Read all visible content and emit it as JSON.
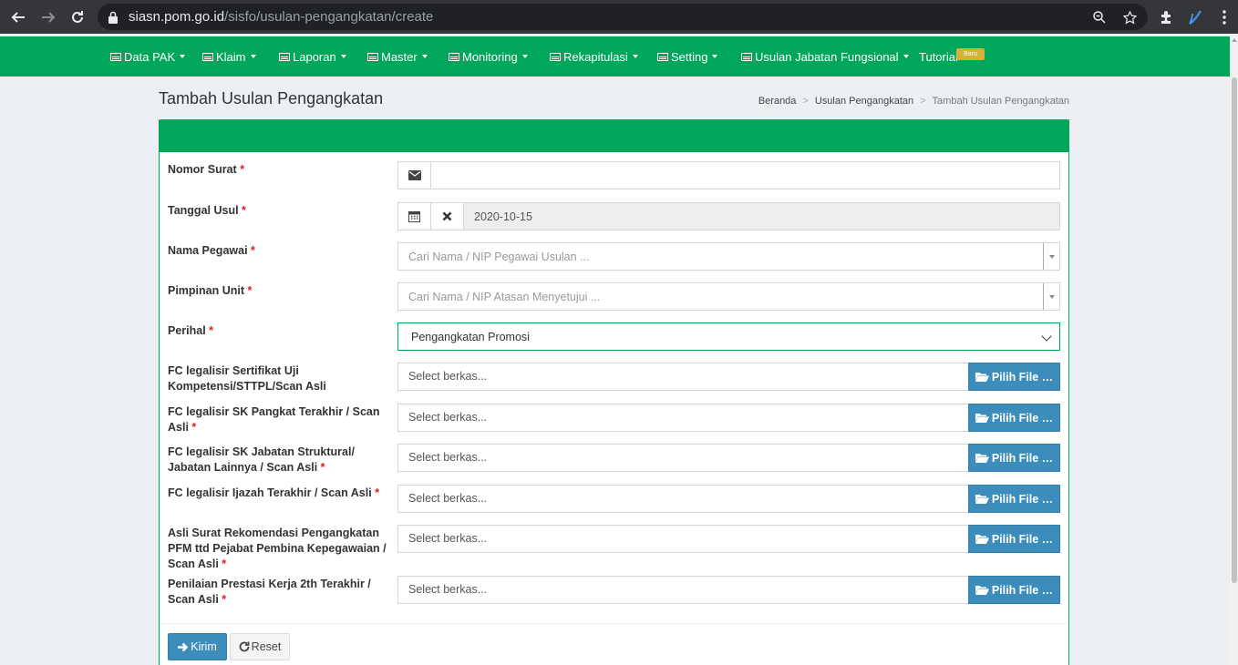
{
  "browser": {
    "url_host": "siasn.pom.go.id",
    "url_path": "/sisfo/usulan-pengangkatan/create"
  },
  "nav": {
    "items": [
      {
        "label": "Data PAK",
        "icon": "table-icon",
        "dropdown": true
      },
      {
        "label": "Klaim",
        "icon": "table-icon",
        "dropdown": true
      },
      {
        "label": "Laporan",
        "icon": "table-icon",
        "dropdown": true
      },
      {
        "label": "Master",
        "icon": "table-icon",
        "dropdown": true
      },
      {
        "label": "Monitoring",
        "icon": "table-icon",
        "dropdown": true
      },
      {
        "label": "Rekapitulasi",
        "icon": "table-icon",
        "dropdown": true
      },
      {
        "label": "Setting",
        "icon": "table-icon",
        "dropdown": true
      },
      {
        "label": "Usulan Jabatan Fungsional",
        "icon": "table-icon",
        "dropdown": true
      },
      {
        "label": "Tutorial",
        "dropdown": false
      }
    ],
    "tutorial_badge": "Baru"
  },
  "page": {
    "title": "Tambah Usulan Pengangkatan",
    "breadcrumb": [
      "Beranda",
      "Usulan Pengangkatan",
      "Tambah Usulan Pengangkatan"
    ]
  },
  "form": {
    "required_mark": "*",
    "nomor_surat": {
      "label": "Nomor Surat",
      "value": ""
    },
    "tanggal_usul": {
      "label": "Tanggal Usul",
      "value": "2020-10-15"
    },
    "nama_pegawai": {
      "label": "Nama Pegawai",
      "placeholder": "Cari Nama / NIP Pegawai Usulan ..."
    },
    "pimpinan_unit": {
      "label": "Pimpinan Unit",
      "placeholder": "Cari Nama / NIP Atasan Menyetujui ..."
    },
    "perihal": {
      "label": "Perihal",
      "value": "Pengangkatan Promosi"
    },
    "files": [
      {
        "label_lines": [
          "FC legalisir Sertifikat Uji",
          "Kompetensi/STTPL/Scan Asli"
        ],
        "required": false,
        "placeholder": "Select berkas..."
      },
      {
        "label_lines": [
          "FC legalisir SK Pangkat Terakhir / Scan",
          "Asli"
        ],
        "required": true,
        "placeholder": "Select berkas..."
      },
      {
        "label_lines": [
          "FC legalisir SK Jabatan Struktural/",
          "Jabatan Lainnya / Scan Asli"
        ],
        "required": true,
        "placeholder": "Select berkas..."
      },
      {
        "label_lines": [
          "FC legalisir Ijazah Terakhir / Scan Asli"
        ],
        "required": true,
        "placeholder": "Select berkas..."
      },
      {
        "label_lines": [
          "Asli Surat Rekomendasi Pengangkatan",
          "PFM ttd Pejabat Pembina Kepegawaian /",
          "Scan Asli"
        ],
        "required": true,
        "placeholder": "Select berkas..."
      },
      {
        "label_lines": [
          "Penilaian Prestasi Kerja 2th Terakhir /",
          "Scan Asli"
        ],
        "required": true,
        "placeholder": "Select berkas..."
      }
    ],
    "pick_file_label": "Pilih File …",
    "submit_label": "Kirim",
    "reset_label": "Reset"
  }
}
